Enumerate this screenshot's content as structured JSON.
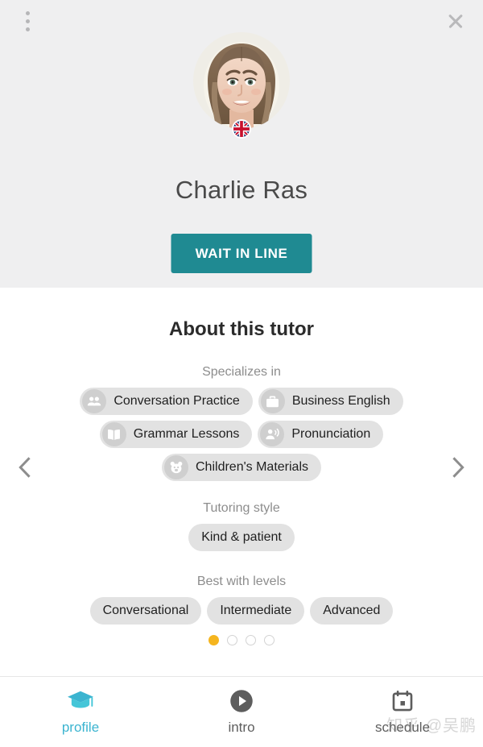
{
  "header": {
    "menu_icon": "kebab-menu-icon",
    "close_icon": "close-icon",
    "avatar_alt": "tutor-avatar",
    "flag": "uk-flag-badge",
    "tutor_name": "Charlie Ras",
    "cta_label": "WAIT IN LINE",
    "cta_color": "#1f8a92",
    "background": "#efeff0"
  },
  "about": {
    "title": "About this tutor",
    "specializes_label": "Specializes in",
    "specializes": [
      {
        "label": "Conversation Practice",
        "icon": "group-people-icon"
      },
      {
        "label": "Business English",
        "icon": "briefcase-icon"
      },
      {
        "label": "Grammar Lessons",
        "icon": "open-book-icon"
      },
      {
        "label": "Pronunciation",
        "icon": "speaking-person-icon"
      },
      {
        "label": "Children's Materials",
        "icon": "teddy-bear-icon"
      }
    ],
    "style_label": "Tutoring style",
    "styles": [
      {
        "label": "Kind & patient"
      }
    ],
    "levels_label": "Best with levels",
    "levels": [
      {
        "label": "Conversational"
      },
      {
        "label": "Intermediate"
      },
      {
        "label": "Advanced"
      }
    ],
    "prev_icon": "chevron-left-icon",
    "next_icon": "chevron-right-icon",
    "pagination": {
      "total": 4,
      "active_index": 0,
      "active_color": "#f5b51f"
    }
  },
  "bottom_nav": {
    "active_color": "#3bb4d0",
    "items": [
      {
        "label": "profile",
        "icon": "graduation-cap-icon",
        "active": true
      },
      {
        "label": "intro",
        "icon": "play-circle-icon",
        "active": false
      },
      {
        "label": "schedule",
        "icon": "calendar-icon",
        "active": false
      }
    ]
  },
  "watermark": {
    "text": "知乎 @吴鹏"
  }
}
